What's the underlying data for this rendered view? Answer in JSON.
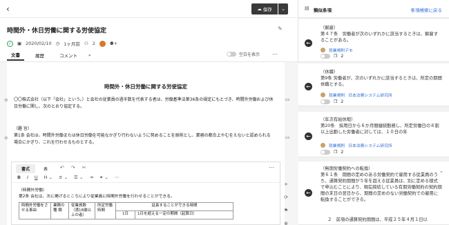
{
  "header": {
    "save_label": "保存"
  },
  "doc": {
    "title": "時間外・休日労働に関する労使協定",
    "date": "2020/02/10",
    "relative": "1ヶ月前",
    "collab_count": "2",
    "tabs": [
      {
        "label": "文書"
      },
      {
        "label": "履歴"
      },
      {
        "label": "コメント"
      }
    ],
    "blank_toggle_label": "空白を表示",
    "center_title": "時間外・休日労働に関する労使協定",
    "para1_l1": "〇〇株式会社（以下「会社」という。）と会社の従業員の過半数を代表する者は、労働基準法第36条の規定にもとづき、時間外労働および休",
    "para1_l2": "日労働に関し、次のとおり協定する。",
    "para2_head": "（趣 旨）",
    "para2_l1": "第1条 会社は、時間外労働または休日労働を可能なかぎり行わないように努めることを原則とし、業務の都合上やむをえないと認められる",
    "para2_l2": "場合にかぎり、これを行わせるものとする。"
  },
  "editor": {
    "tabs": [
      {
        "label": "書式"
      },
      {
        "label": "表"
      }
    ],
    "line1": "（時間外労働）",
    "line2": "第2条 会社は、次に掲げるところにより従業員に時間外労働を行わせることができる。",
    "table": {
      "h1": "時間外労働をさせる事由",
      "h2": "業務の種 類",
      "h3": "従業員数（満18歳以上の者）",
      "h4": "所定労働時間",
      "h5": "延長することができる時間",
      "r1": "1日",
      "r2": "1日を超える一定の期間（起算日）"
    }
  },
  "panel": {
    "title": "類似条項",
    "back_link": "条項検索に戻る",
    "cards": [
      {
        "heading": "（解雇）",
        "text": "第４７条　労働者が次のいずれかに該当するときは、解雇することがある。",
        "tag1": "就業規則デモ",
        "tag2": "",
        "count": "2"
      },
      {
        "heading": "（休職）",
        "text": "第9条 労働者が、次のいずれかに該当するときは、所定の期間休職とする。",
        "tag1": "就業規則",
        "tag2": "日本法務システム研究所",
        "count": "2"
      },
      {
        "heading": "（年次有給休暇）",
        "text": "第20条　採用日から６か月間継続勤務し、所定労働日の８割以上出勤した労働者に対しては、１０日の年",
        "tag1": "就業規則",
        "tag2": "日本法務システム研究所",
        "count": "2"
      },
      {
        "heading": "（無期労働契約への転換）",
        "text": "第６１条　期間の定めのある労働契約で雇用する従業員のうち、通算契約期間が５年を超える従業員は、別に定める様式で申込むことにより、現在締結している有期労働契約の契約期間の末日の翌日から、期間の定めのない労働契約での雇用に転換することができる。",
        "text2": "２　前項の通算契約期間は、平成２５年４月１日以"
      }
    ]
  }
}
